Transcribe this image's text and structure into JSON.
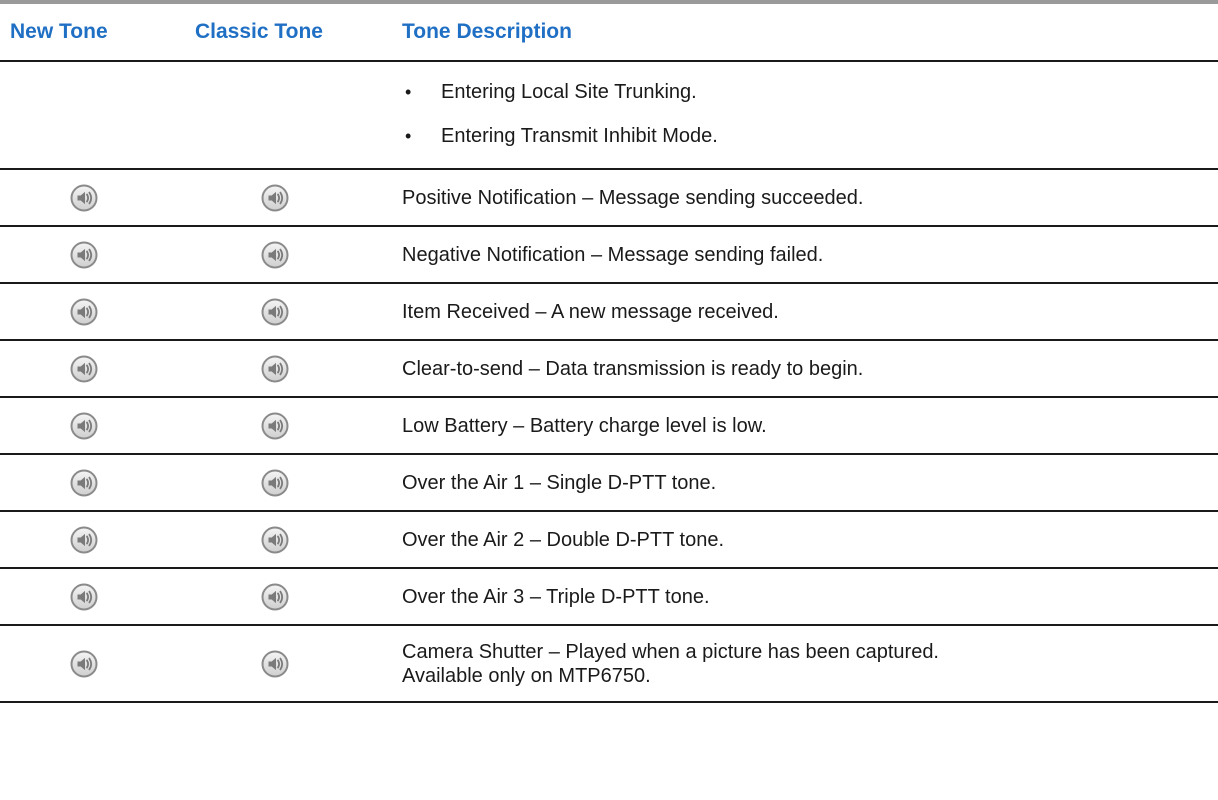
{
  "table": {
    "headers": {
      "new_tone": "New Tone",
      "classic_tone": "Classic Tone",
      "description": "Tone Description"
    },
    "continued_bullets": [
      "Entering Local Site Trunking.",
      "Entering Transmit Inhibit Mode."
    ],
    "rows": [
      {
        "new_icon": "speaker-icon",
        "classic_icon": "speaker-icon",
        "description": "Positive Notification – Message sending succeeded."
      },
      {
        "new_icon": "speaker-icon",
        "classic_icon": "speaker-icon",
        "description": "Negative Notification – Message sending failed."
      },
      {
        "new_icon": "speaker-icon",
        "classic_icon": "speaker-icon",
        "description": "Item Received – A new message received."
      },
      {
        "new_icon": "speaker-icon",
        "classic_icon": "speaker-icon",
        "description": "Clear-to-send – Data transmission is ready to begin."
      },
      {
        "new_icon": "speaker-icon",
        "classic_icon": "speaker-icon",
        "description": "Low Battery – Battery charge level is low."
      },
      {
        "new_icon": "speaker-icon",
        "classic_icon": "speaker-icon",
        "description": "Over the Air 1 – Single D-PTT tone."
      },
      {
        "new_icon": "speaker-icon",
        "classic_icon": "speaker-icon",
        "description": "Over the Air 2 – Double D-PTT tone."
      },
      {
        "new_icon": "speaker-icon",
        "classic_icon": "speaker-icon",
        "description": "Over the Air 3 – Triple D-PTT tone."
      },
      {
        "new_icon": "speaker-icon",
        "classic_icon": "speaker-icon",
        "description_lines": [
          "Camera Shutter – Played when a picture has been captured.",
          "Available only on MTP6750."
        ]
      }
    ]
  },
  "colors": {
    "header_text": "#1f6fc4",
    "rule": "#1a1a1a",
    "top_rule": "#9a9a9a"
  }
}
